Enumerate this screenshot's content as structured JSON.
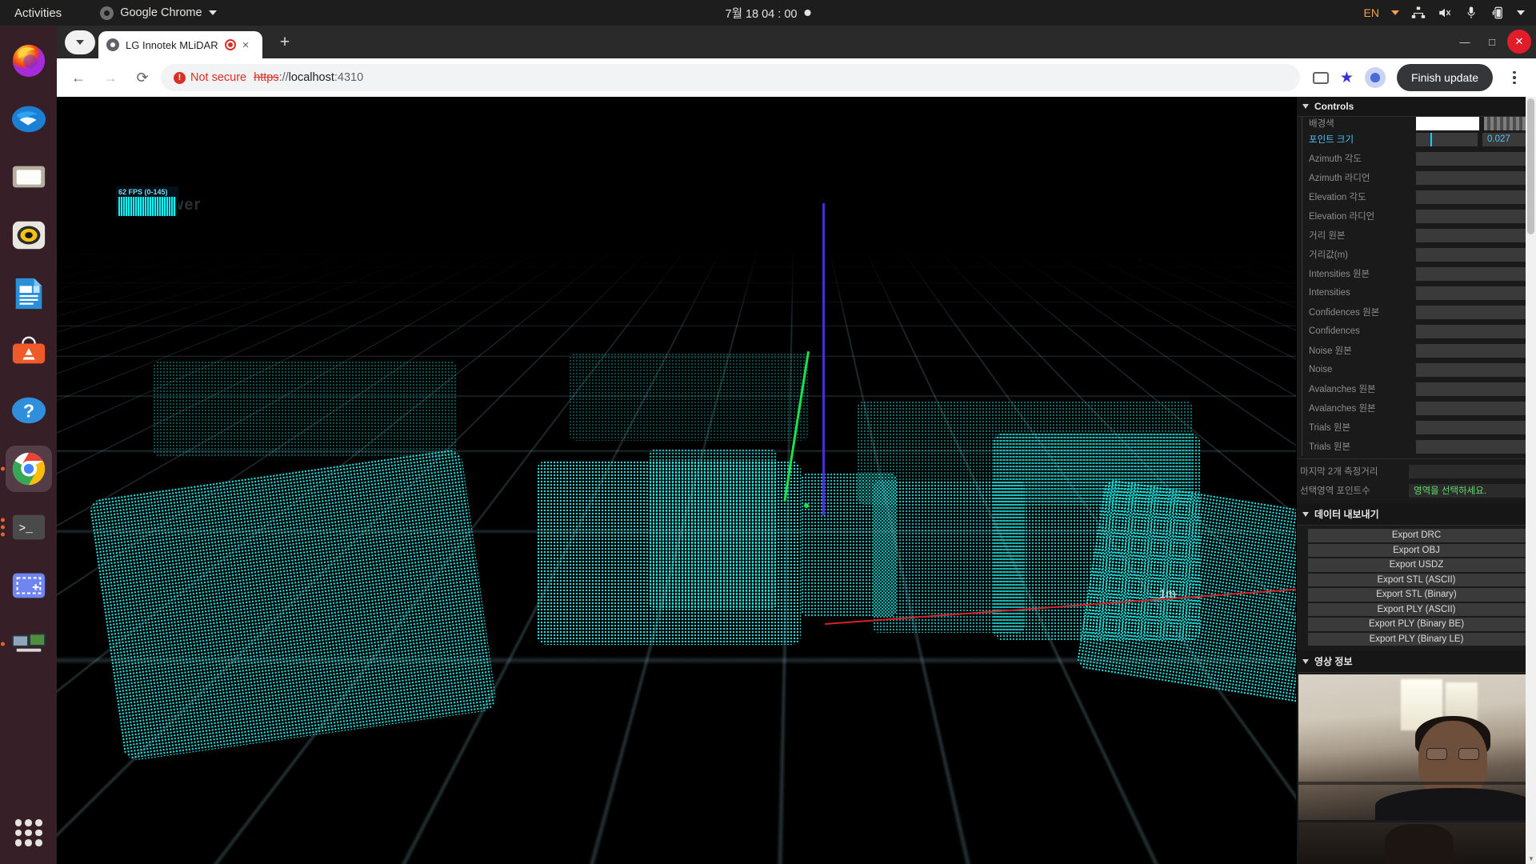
{
  "topbar": {
    "activities": "Activities",
    "app_menu": "Google Chrome",
    "clock": "7월 18  04 : 00",
    "language": "EN",
    "icons": [
      "network-icon",
      "volume-muted-icon",
      "microphone-icon",
      "battery-charging-icon",
      "chevron-down-icon"
    ]
  },
  "dock": {
    "items": [
      {
        "name": "firefox",
        "label": "Firefox"
      },
      {
        "name": "thunderbird",
        "label": "Thunderbird"
      },
      {
        "name": "files",
        "label": "Files"
      },
      {
        "name": "rhythmbox",
        "label": "Rhythmbox"
      },
      {
        "name": "libreoffice-writer",
        "label": "LibreOffice Writer"
      },
      {
        "name": "ubuntu-software",
        "label": "Ubuntu Software"
      },
      {
        "name": "help",
        "label": "Help"
      },
      {
        "name": "google-chrome",
        "label": "Google Chrome"
      },
      {
        "name": "terminal",
        "label": "Terminal"
      },
      {
        "name": "screenshot",
        "label": "Screenshot"
      },
      {
        "name": "displays",
        "label": "Displays"
      }
    ],
    "show_apps": "Show Applications"
  },
  "browser": {
    "tab": {
      "title": "LG Innotek MLiDAR",
      "recording": true,
      "close_label": "×"
    },
    "new_tab": "+",
    "window_buttons": {
      "minimize": "—",
      "maximize": "□",
      "close": "✕"
    },
    "nav": {
      "back": "←",
      "forward": "→",
      "reload": "⟳"
    },
    "omnibox": {
      "security_label": "Not secure",
      "scheme": "https",
      "separator": "://",
      "host": "localhost",
      "port": ":4310"
    },
    "finish_update": "Finish update",
    "kebab": "more-menu"
  },
  "viewport": {
    "fps_label": "62 FPS (0-145)",
    "watermark": "3D Viewer",
    "scale_label": "1m",
    "axes": {
      "x_color": "#d8202c",
      "y_color": "#19e34a",
      "z_color": "#4a2ae0"
    },
    "point_color": "#1ff3ee"
  },
  "panel": {
    "controls": {
      "title": "Controls",
      "rows": [
        {
          "name": "배경색",
          "type": "color",
          "value": "",
          "active": false,
          "clipped": true
        },
        {
          "name": "포인트 크기",
          "type": "slider",
          "value": "0.027",
          "active": true
        },
        {
          "name": "Azimuth 각도",
          "type": "field",
          "value": "",
          "active": false
        },
        {
          "name": "Azimuth 라디언",
          "type": "field",
          "value": "",
          "active": false
        },
        {
          "name": "Elevation 각도",
          "type": "field",
          "value": "",
          "active": false
        },
        {
          "name": "Elevation 라디언",
          "type": "field",
          "value": "",
          "active": false
        },
        {
          "name": "거리 원본",
          "type": "field",
          "value": "",
          "active": false
        },
        {
          "name": "거리값(m)",
          "type": "field",
          "value": "",
          "active": false
        },
        {
          "name": "Intensities 원본",
          "type": "field",
          "value": "",
          "active": false
        },
        {
          "name": "Intensities",
          "type": "field",
          "value": "",
          "active": false
        },
        {
          "name": "Confidences 원본",
          "type": "field",
          "value": "",
          "active": false
        },
        {
          "name": "Confidences",
          "type": "field",
          "value": "",
          "active": false
        },
        {
          "name": "Noise 원본",
          "type": "field",
          "value": "",
          "active": false
        },
        {
          "name": "Noise",
          "type": "field",
          "value": "",
          "active": false
        },
        {
          "name": "Avalanches 원본",
          "type": "field",
          "value": "",
          "active": false
        },
        {
          "name": "Avalanches 원본",
          "type": "field",
          "value": "",
          "active": false
        },
        {
          "name": "Trials 원본",
          "type": "field",
          "value": "",
          "active": false
        },
        {
          "name": "Trials 원본",
          "type": "field",
          "value": "",
          "active": false
        }
      ],
      "wide_rows": [
        {
          "name": "마지막 2개 측정거리",
          "value": "",
          "style": "plain"
        },
        {
          "name": "선택영역 포인트수",
          "value": "영역을 선택하세요.",
          "style": "green"
        }
      ]
    },
    "export": {
      "title": "데이터 내보내기",
      "buttons": [
        "Export DRC",
        "Export OBJ",
        "Export USDZ",
        "Export STL (ASCII)",
        "Export STL (Binary)",
        "Export PLY (ASCII)",
        "Export PLY (Binary BE)",
        "Export PLY (Binary LE)"
      ]
    },
    "video": {
      "title": "영상 정보"
    }
  }
}
